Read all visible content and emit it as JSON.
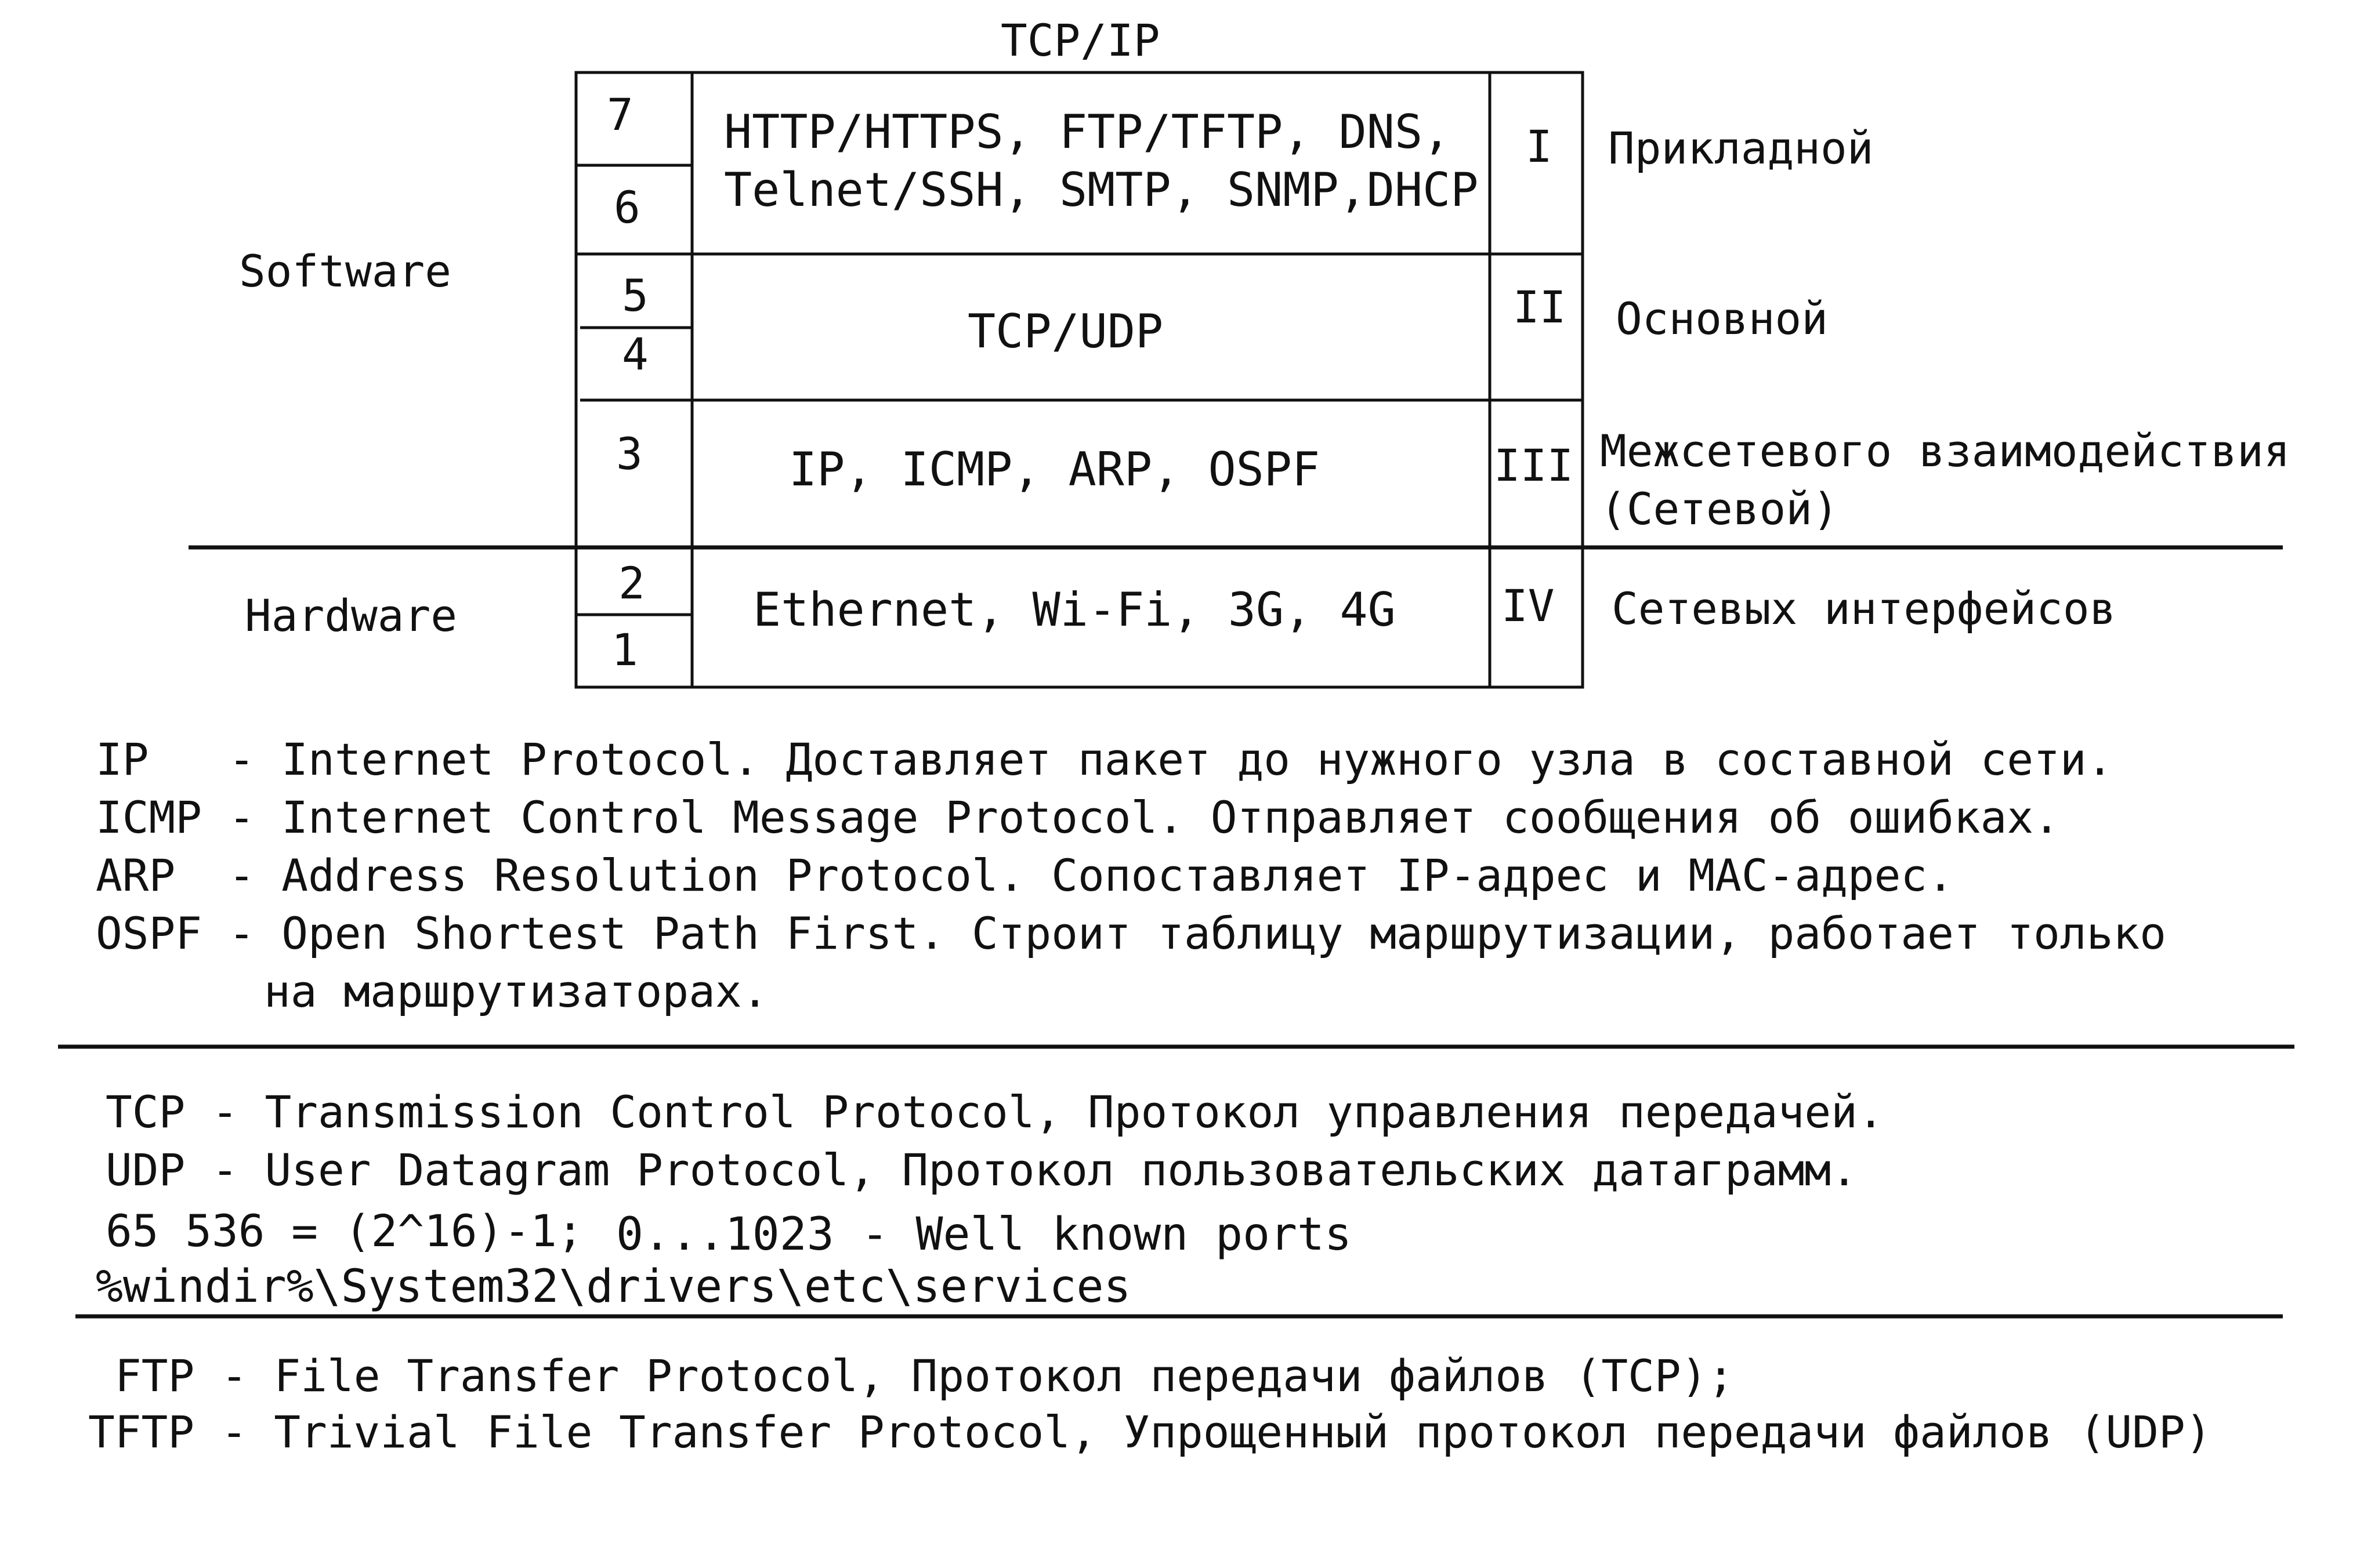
{
  "diagram": {
    "title": "TCP/IP",
    "left_labels": {
      "software": "Software",
      "hardware": "Hardware"
    },
    "osi_numbers": [
      "7",
      "6",
      "5",
      "4",
      "3",
      "2",
      "1"
    ],
    "rows": [
      {
        "protocols": [
          "HTTP/HTTPS, FTP/TFTP, DNS,",
          "Telnet/SSH, SMTP, SNMP,DHCP"
        ],
        "roman": "I",
        "layer": [
          "Прикладной"
        ]
      },
      {
        "protocols": [
          "TCP/UDP"
        ],
        "roman": "II",
        "layer": [
          "Основной"
        ]
      },
      {
        "protocols": [
          "IP, ICMP, ARP, OSPF"
        ],
        "roman": "III",
        "layer": [
          "Межсетевого взаимодействия",
          "(Сетевой)"
        ]
      },
      {
        "protocols": [
          "Ethernet, Wi-Fi, 3G, 4G"
        ],
        "roman": "IV",
        "layer": [
          "Сетевых интерфейсов"
        ]
      }
    ]
  },
  "definitions": {
    "ip": "IP   - Internet Protocol. Доставляет пакет до нужного узла в составной сети.",
    "icmp": "ICMP - Internet Control Message Protocol. Отправляет сообщения об ошибках.",
    "arp": "ARP  - Address Resolution Protocol. Сопоставляет IP-адрес и MAC-адрес.",
    "ospf": "OSPF - Open Shortest Path First. Строит таблицу маршрутизации, работает только",
    "ospf_cont": "на маршрутизаторах."
  },
  "transport": {
    "tcp": "TCP - Transmission Control Protocol, Протокол управления передачей.",
    "udp": "UDP - User Datagram Protocol, Протокол пользовательских датаграмм.",
    "ports_a": "65 536 = (2^16)-1;",
    "ports_b": "0...1023 - Well known ports",
    "services_path": "%windir%\\System32\\drivers\\etc\\services"
  },
  "file_transfer": {
    "ftp": "FTP - File Transfer Protocol, Протокол передачи файлов (TCP);",
    "tftp": "TFTP - Trivial File Transfer Protocol, Упрощенный протокол передачи файлов (UDP)"
  },
  "colors": {
    "ink": "#111111",
    "background": "#ffffff"
  }
}
